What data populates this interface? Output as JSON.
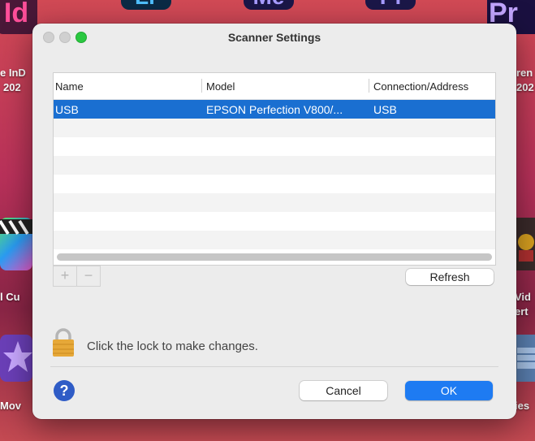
{
  "desktop": {
    "icons": [
      {
        "glyph": "Id",
        "label": "e InD",
        "label2": "202",
        "color": "#4a1838"
      },
      {
        "glyph": "Lr",
        "label": "",
        "label2": "",
        "color": "#0b2a45"
      },
      {
        "glyph": "Me",
        "label": "",
        "label2": "",
        "color": "#1a1648"
      },
      {
        "glyph": "Pl",
        "label": "",
        "label2": "",
        "color": "#1b1748"
      },
      {
        "glyph": "Pr",
        "label": "ren",
        "label2": "202",
        "color": "#1a1040"
      }
    ],
    "side_labels": {
      "left1": "l Cu",
      "left2": "Mov",
      "right1": "Vid",
      "right1b": "ert",
      "right2": "ies"
    }
  },
  "dialog": {
    "title": "Scanner Settings",
    "colors": {
      "accent": "#1e7bf2",
      "selection": "#1a6fd1"
    },
    "table": {
      "columns": [
        "Name",
        "Model",
        "Connection/Address"
      ],
      "rows": [
        {
          "name": "USB",
          "model": "EPSON Perfection V800/...",
          "connection": "USB",
          "selected": true
        }
      ]
    },
    "add_label": "+",
    "remove_label": "−",
    "refresh_label": "Refresh",
    "lock_text": "Click the lock to make changes.",
    "help_label": "?",
    "cancel_label": "Cancel",
    "ok_label": "OK"
  }
}
